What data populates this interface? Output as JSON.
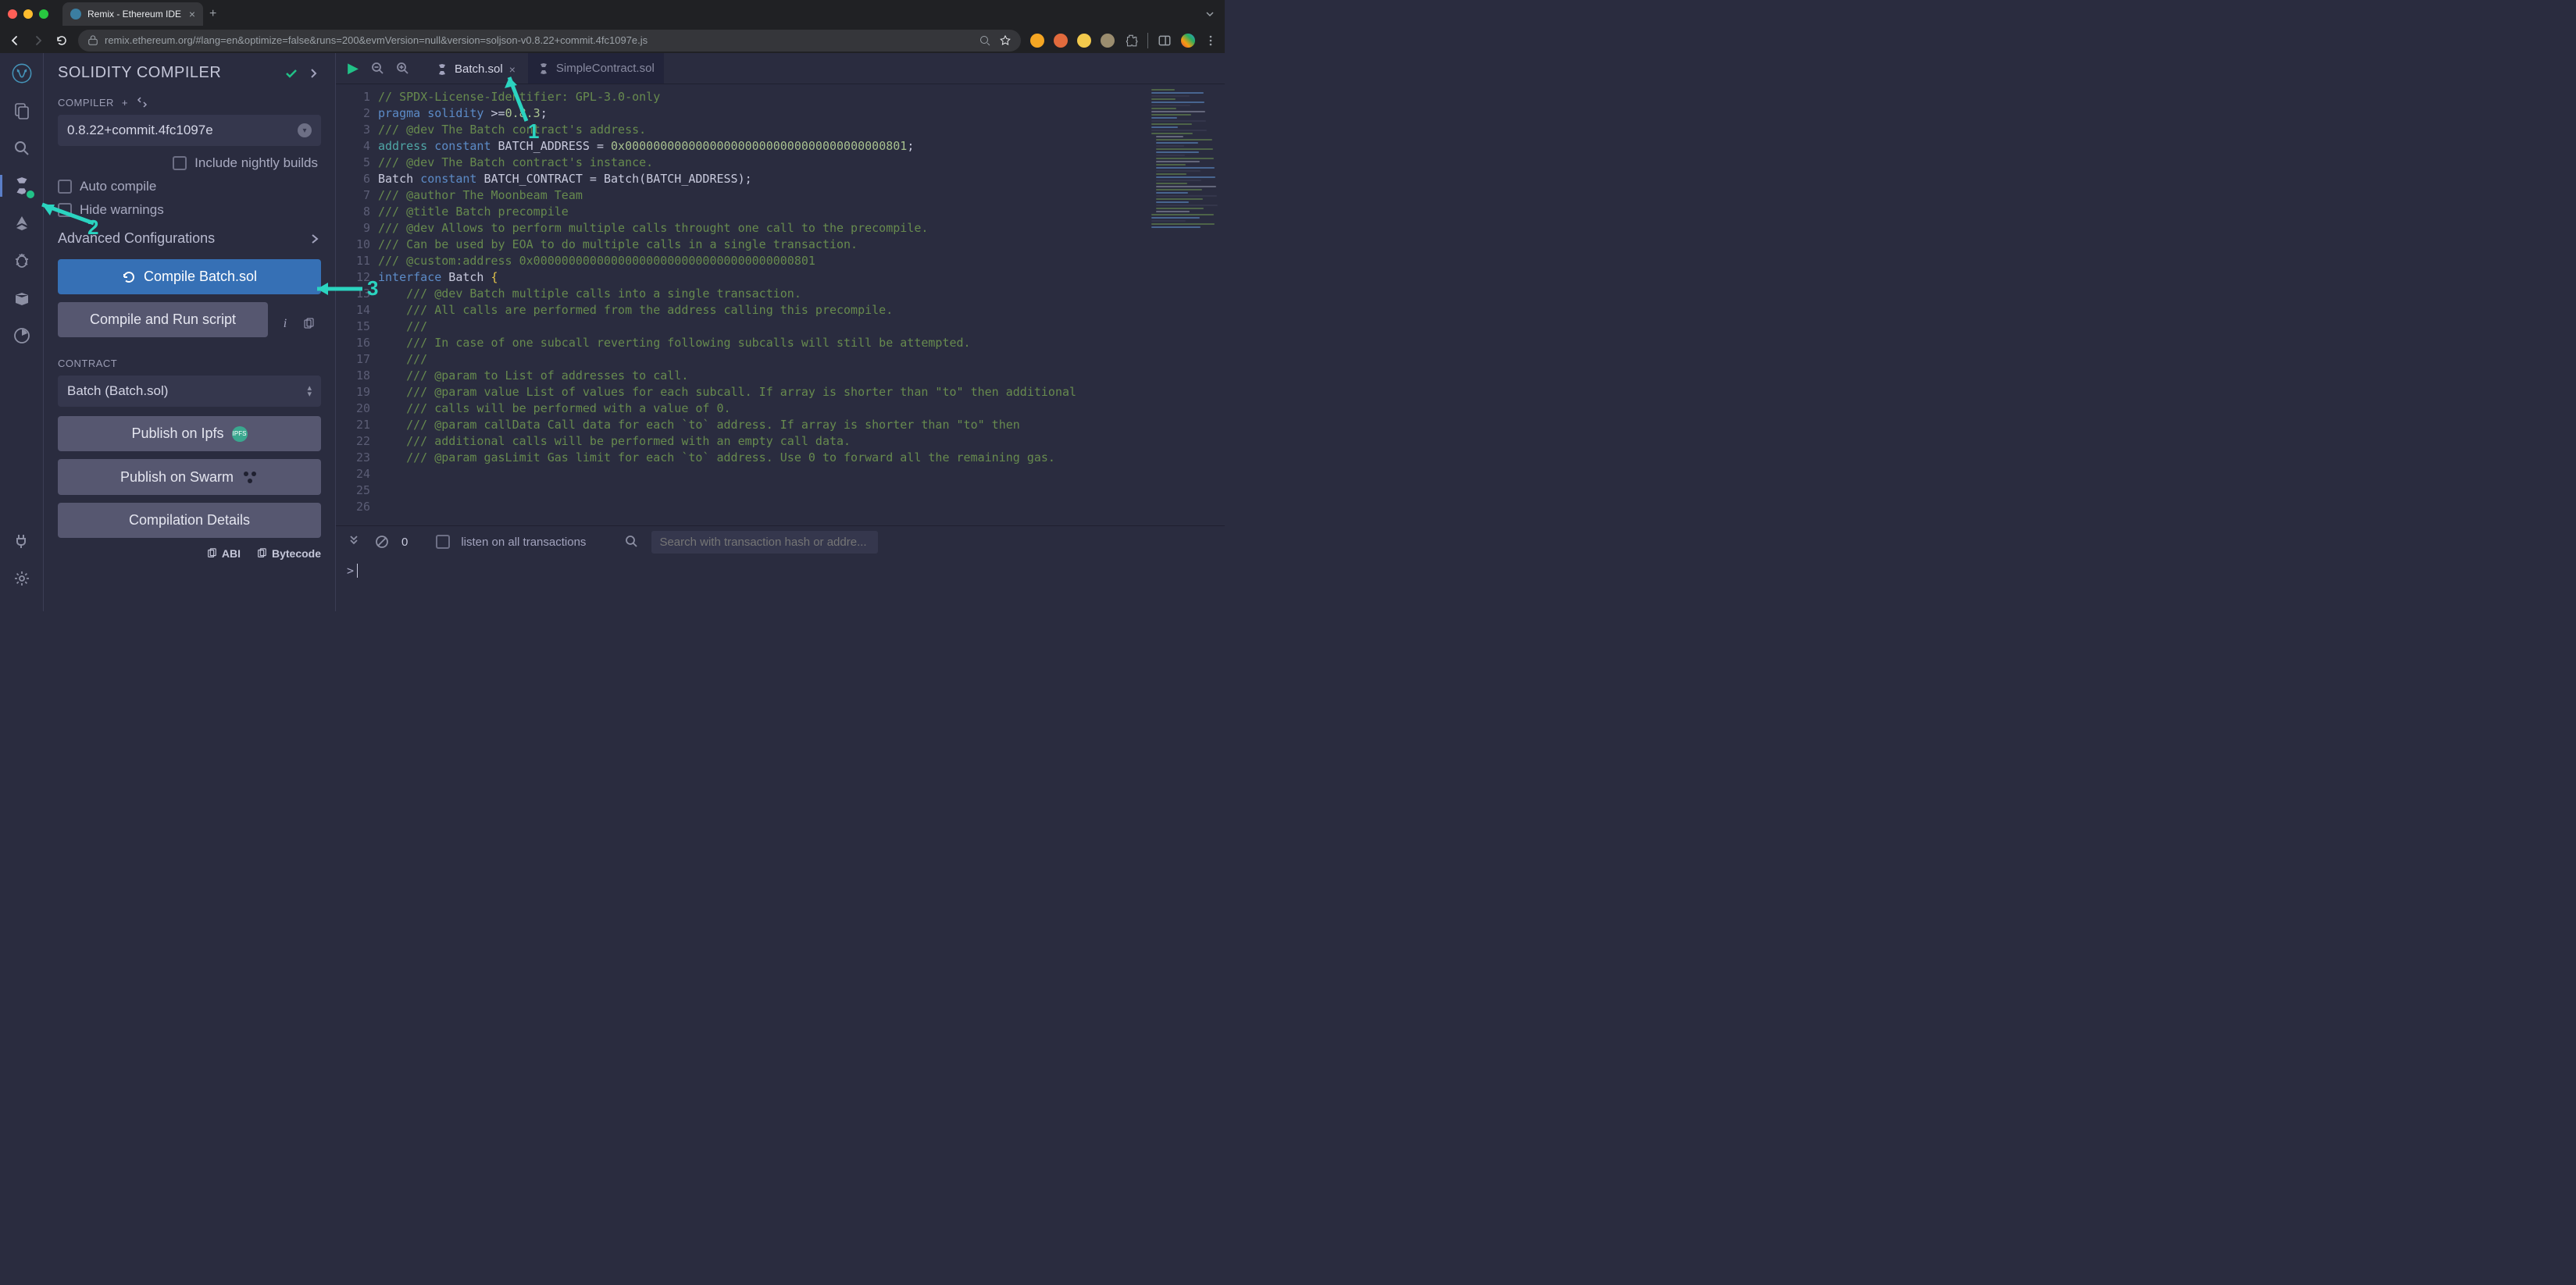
{
  "browser": {
    "tab_title": "Remix - Ethereum IDE",
    "url": "remix.ethereum.org/#lang=en&optimize=false&runs=200&evmVersion=null&version=soljson-v0.8.22+commit.4fc1097e.js"
  },
  "panel": {
    "title": "SOLIDITY COMPILER",
    "compiler_label": "COMPILER",
    "compiler_version": "0.8.22+commit.4fc1097e",
    "nightly_label": "Include nightly builds",
    "autocompile_label": "Auto compile",
    "hidewarnings_label": "Hide warnings",
    "advanced_label": "Advanced Configurations",
    "compile_btn": "Compile Batch.sol",
    "compilerun_btn": "Compile and Run script",
    "contract_label": "CONTRACT",
    "contract_selected": "Batch (Batch.sol)",
    "publish_ipfs": "Publish on Ipfs",
    "publish_swarm": "Publish on Swarm",
    "compilation_details": "Compilation Details",
    "abi_label": "ABI",
    "bytecode_label": "Bytecode"
  },
  "editor": {
    "tabs": [
      {
        "name": "Batch.sol",
        "active": true
      },
      {
        "name": "SimpleContract.sol",
        "active": false
      }
    ],
    "lines": [
      [
        [
          "comment",
          "// SPDX-License-Identifier: GPL-3.0-only"
        ]
      ],
      [
        [
          "keyword",
          "pragma"
        ],
        [
          "ident",
          " "
        ],
        [
          "keyword",
          "solidity"
        ],
        [
          "ident",
          " >="
        ],
        [
          "number",
          "0.8.3"
        ],
        [
          "punc",
          ";"
        ]
      ],
      [
        [
          "",
          ""
        ]
      ],
      [
        [
          "comment",
          "/// @dev The Batch contract's address."
        ]
      ],
      [
        [
          "type",
          "address"
        ],
        [
          "ident",
          " "
        ],
        [
          "const",
          "constant"
        ],
        [
          "ident",
          " BATCH_ADDRESS = "
        ],
        [
          "number",
          "0x0000000000000000000000000000000000000801"
        ],
        [
          "punc",
          ";"
        ]
      ],
      [
        [
          "",
          ""
        ]
      ],
      [
        [
          "comment",
          "/// @dev The Batch contract's instance."
        ]
      ],
      [
        [
          "ident",
          "Batch "
        ],
        [
          "const",
          "constant"
        ],
        [
          "ident",
          " BATCH_CONTRACT = Batch"
        ],
        [
          "punc",
          "("
        ],
        [
          "ident",
          "BATCH_ADDRESS"
        ],
        [
          "punc",
          ")"
        ],
        [
          "punc",
          ";"
        ]
      ],
      [
        [
          "",
          ""
        ]
      ],
      [
        [
          "comment",
          "/// @author The Moonbeam Team"
        ]
      ],
      [
        [
          "comment",
          "/// @title Batch precompile"
        ]
      ],
      [
        [
          "comment",
          "/// @dev Allows to perform multiple calls throught one call to the precompile."
        ]
      ],
      [
        [
          "comment",
          "/// Can be used by EOA to do multiple calls in a single transaction."
        ]
      ],
      [
        [
          "comment",
          "/// @custom:address 0x0000000000000000000000000000000000000801"
        ]
      ],
      [
        [
          "keyword",
          "interface"
        ],
        [
          "ident",
          " Batch "
        ],
        [
          "brace",
          "{"
        ]
      ],
      [
        [
          "comment",
          "    /// @dev Batch multiple calls into a single transaction."
        ]
      ],
      [
        [
          "comment",
          "    /// All calls are performed from the address calling this precompile."
        ]
      ],
      [
        [
          "comment",
          "    ///"
        ]
      ],
      [
        [
          "comment",
          "    /// In case of one subcall reverting following subcalls will still be attempted."
        ]
      ],
      [
        [
          "comment",
          "    ///"
        ]
      ],
      [
        [
          "comment",
          "    /// @param to List of addresses to call."
        ]
      ],
      [
        [
          "comment",
          "    /// @param value List of values for each subcall. If array is shorter than \"to\" then additional"
        ]
      ],
      [
        [
          "comment",
          "    /// calls will be performed with a value of 0."
        ]
      ],
      [
        [
          "comment",
          "    /// @param callData Call data for each `to` address. If array is shorter than \"to\" then"
        ]
      ],
      [
        [
          "comment",
          "    /// additional calls will be performed with an empty call data."
        ]
      ],
      [
        [
          "comment",
          "    /// @param gasLimit Gas limit for each `to` address. Use 0 to forward all the remaining gas."
        ]
      ]
    ]
  },
  "terminal": {
    "count": "0",
    "listen_label": "listen on all transactions",
    "search_placeholder": "Search with transaction hash or addre...",
    "prompt": ">"
  },
  "annotations": {
    "n1": "1",
    "n2": "2",
    "n3": "3"
  }
}
